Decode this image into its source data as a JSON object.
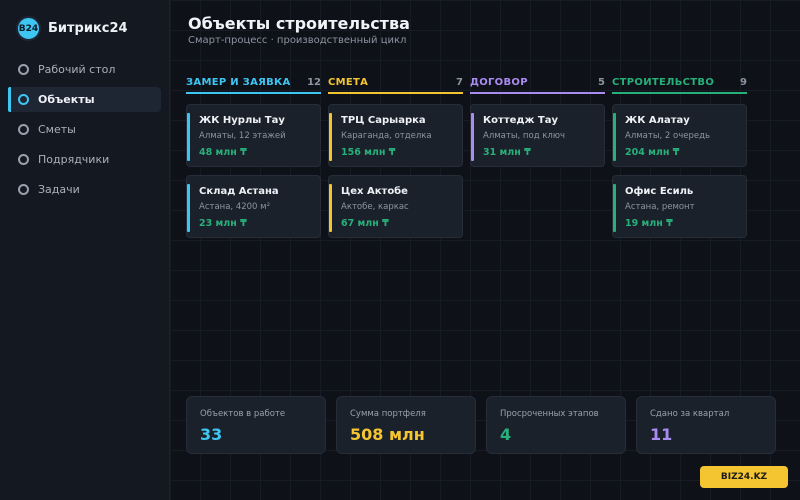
{
  "brand": {
    "logo": "B24",
    "name": "Битрикс24"
  },
  "nav": [
    {
      "label": "Рабочий стол",
      "active": false
    },
    {
      "label": "Объекты",
      "active": true
    },
    {
      "label": "Сметы",
      "active": false
    },
    {
      "label": "Подрядчики",
      "active": false
    },
    {
      "label": "Задачи",
      "active": false
    }
  ],
  "page": {
    "title": "Объекты строительства",
    "subtitle": "Смарт-процесс · производственный цикл"
  },
  "columns": [
    {
      "title": "ЗАМЕР И ЗАЯВКА",
      "count": "12",
      "color": "#3ec6f2",
      "cards": [
        {
          "name": "ЖК Нурлы Тау",
          "meta": "Алматы, 12 этажей",
          "price": "48 млн ₸"
        },
        {
          "name": "Склад Астана",
          "meta": "Астана, 4200 м²",
          "price": "23 млн ₸"
        }
      ]
    },
    {
      "title": "СМЕТА",
      "count": "7",
      "color": "#f5c531",
      "cards": [
        {
          "name": "ТРЦ Сарыарка",
          "meta": "Караганда, отделка",
          "price": "156 млн ₸"
        },
        {
          "name": "Цех Актобе",
          "meta": "Актобе, каркас",
          "price": "67 млн ₸"
        }
      ]
    },
    {
      "title": "ДОГОВОР",
      "count": "5",
      "color": "#a98cf0",
      "cards": [
        {
          "name": "Коттедж Тау",
          "meta": "Алматы, под ключ",
          "price": "31 млн ₸"
        }
      ]
    },
    {
      "title": "СТРОИТЕЛЬСТВО",
      "count": "9",
      "color": "#27b07a",
      "cards": [
        {
          "name": "ЖК Алатау",
          "meta": "Алматы, 2 очередь",
          "price": "204 млн ₸"
        },
        {
          "name": "Офис Есиль",
          "meta": "Астана, ремонт",
          "price": "19 млн ₸"
        }
      ]
    }
  ],
  "stats": [
    {
      "label": "Объектов в работе",
      "value": "33",
      "color": "#3ec6f2"
    },
    {
      "label": "Сумма портфеля",
      "value": "508 млн",
      "color": "#f5c531"
    },
    {
      "label": "Просроченных этапов",
      "value": "4",
      "color": "#27b07a"
    },
    {
      "label": "Сдано за квартал",
      "value": "11",
      "color": "#a98cf0"
    }
  ],
  "badge": "BIZ24.KZ",
  "colors": {
    "accent": "#3ec6f2",
    "price": "#27b07a",
    "badge": "#f5c531"
  }
}
